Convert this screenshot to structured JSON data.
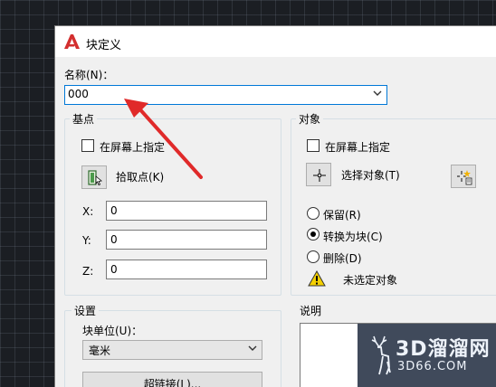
{
  "dialog": {
    "title": "块定义",
    "app_icon": "autocad-a-icon"
  },
  "name": {
    "label": "名称(N)：",
    "value": "000"
  },
  "base_point": {
    "title": "基点",
    "specify_on_screen": "在屏幕上指定",
    "pick_point": "拾取点(K)",
    "x_label": "X:",
    "x_value": "0",
    "y_label": "Y:",
    "y_value": "0",
    "z_label": "Z:",
    "z_value": "0"
  },
  "objects": {
    "title": "对象",
    "specify_on_screen": "在屏幕上指定",
    "select_objects": "选择对象(T)",
    "retain": "保留(R)",
    "convert_to_block": "转换为块(C)",
    "delete": "删除(D)",
    "selected_option": "convert_to_block",
    "warning": "未选定对象"
  },
  "settings": {
    "title": "设置",
    "block_unit_label": "块单位(U)：",
    "block_unit_value": "毫米",
    "hyperlink_button": "超链接(L)..."
  },
  "description": {
    "title": "说明"
  },
  "watermark": {
    "big": "3D溜溜网",
    "small": "3D66.COM"
  },
  "colors": {
    "annotation_arrow": "#e02a2a",
    "focus_border": "#0078d7",
    "autocad_red": "#d32f2f"
  }
}
